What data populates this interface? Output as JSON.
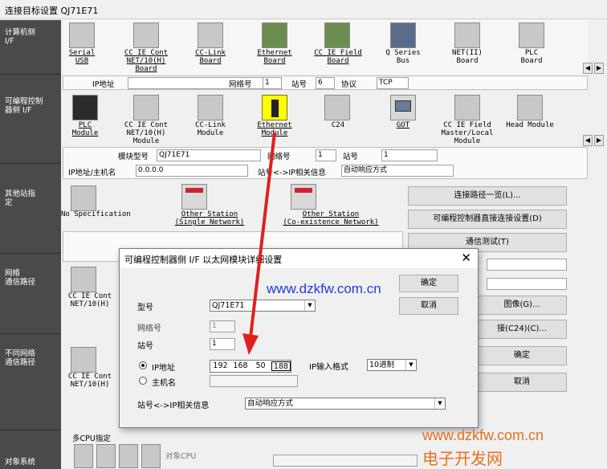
{
  "window": {
    "title": "连接目标设置 QJ71E71"
  },
  "sections": {
    "pc_if": "计算机侧\nI/F",
    "plc_if": "可编程控制\n器侧 I/F",
    "other_station": "其他站指\n定",
    "network_route": "网络\n通信路径",
    "diff_network": "不同网络\n通信路径",
    "target_system": "对象系统"
  },
  "pc_if_items": [
    {
      "label": "Serial\nUSB",
      "icon": "serial-usb-icon"
    },
    {
      "label": "CC IE Cont\nNET/10(H)\nBoard",
      "icon": "cc-ie-cont-board-icon"
    },
    {
      "label": "CC-Link\nBoard",
      "icon": "cc-link-board-icon"
    },
    {
      "label": "Ethernet\nBoard",
      "icon": "ethernet-board-icon"
    },
    {
      "label": "CC IE Field\nBoard",
      "icon": "cc-ie-field-board-icon"
    },
    {
      "label": "Q Series\nBus",
      "icon": "q-series-bus-icon"
    },
    {
      "label": "NET(II)\nBoard",
      "icon": "net-ii-board-icon"
    },
    {
      "label": "PLC\nBoard",
      "icon": "plc-board-icon"
    }
  ],
  "pc_if_fields": {
    "ip_label": "IP地址",
    "ip_value": "",
    "network_label": "网络号",
    "network_value": "1",
    "station_label": "站号",
    "station_value": "6",
    "protocol_label": "协议",
    "protocol_value": "TCP"
  },
  "plc_if_items": [
    {
      "label": "PLC\nModule",
      "icon": "plc-module-icon"
    },
    {
      "label": "CC IE Cont\nNET/10(H)\nModule",
      "icon": "cc-ie-cont-module-icon"
    },
    {
      "label": "CC-Link\nModule",
      "icon": "cc-link-module-icon"
    },
    {
      "label": "Ethernet\nModule",
      "icon": "ethernet-module-icon"
    },
    {
      "label": "C24",
      "icon": "c24-icon"
    },
    {
      "label": "GOT",
      "icon": "got-icon"
    },
    {
      "label": "CC IE Field\nMaster/Local\nModule",
      "icon": "cc-ie-field-master-icon"
    },
    {
      "label": "Head Module",
      "icon": "head-module-icon"
    }
  ],
  "plc_if_fields": {
    "model_label": "模块型号",
    "model_value": "QJ71E71",
    "network_label": "网络号",
    "network_value": "1",
    "station_label": "站号",
    "station_value": "1",
    "ip_label": "IP地址/主机名",
    "ip_value": "0.0.0.0",
    "station_ip_label": "站号<->IP相关信息",
    "station_ip_value": "自动响应方式"
  },
  "other_station_items": [
    {
      "label": "No Specification"
    },
    {
      "label": "Other Station\n(Single Network)"
    },
    {
      "label": "Other Station\n(Co-existence Network)"
    }
  ],
  "right_buttons": {
    "route_list": "连接路径一览(L)...",
    "direct_connect": "可编程控制器直接连接设置(D)",
    "comm_test": "通信测试(T)",
    "image": "图像(G)...",
    "c24_connect": "接(C24)(C)...",
    "ok": "确定",
    "cancel": "取消"
  },
  "route_items": [
    {
      "label": "CC IE Cont\nNET/10(H)"
    },
    {
      "label": "CC IE Cont\nNET/10(H)"
    }
  ],
  "multi_cpu": {
    "label": "多CPU指定",
    "target_cpu": "对象CPU"
  },
  "dialog": {
    "title": "可编程控制器侧 I/F 以太网模块详细设置",
    "ok": "确定",
    "cancel": "取消",
    "model_label": "型号",
    "model_value": "QJ71E71",
    "network_label": "网络号",
    "network_value": "1",
    "station_label": "站号",
    "station_value": "1",
    "ip_radio_label": "IP地址",
    "host_radio_label": "主机名",
    "ip_octets": [
      "192",
      "168",
      "50",
      "188"
    ],
    "ip_format_label": "IP输入格式",
    "ip_format_value": "10进制",
    "station_ip_label": "站号<->IP相关信息",
    "station_ip_value": "自动响应方式"
  },
  "watermarks": {
    "top": "www.dzkfw.com.cn",
    "bottom_url": "www.dzkfw.com.cn",
    "bottom_name": "电子开发网"
  },
  "colors": {
    "left_bar": "#4a4a4a",
    "highlight": "#ffff00",
    "watermark_blue": "#1e3cd8",
    "watermark_orange": "#e8711d",
    "arrow_red": "#e02020"
  }
}
